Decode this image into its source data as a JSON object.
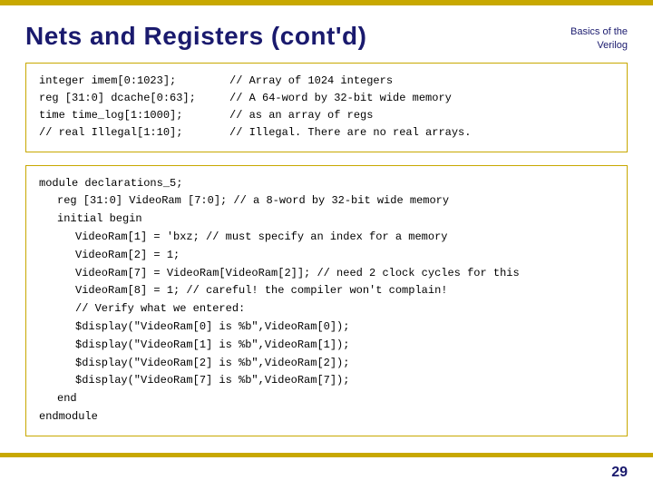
{
  "topBar": {},
  "header": {
    "title": "Nets and Registers (cont'd)",
    "topRightLine1": "Basics of the",
    "topRightLine2": "Verilog"
  },
  "codeBox1": {
    "lines": [
      {
        "col1": "integer imem[0:1023];",
        "col2": "// Array of 1024 integers"
      },
      {
        "col1": "reg [31:0] dcache[0:63];",
        "col2": "// A 64-word by 32-bit wide memory"
      },
      {
        "col1": "time time_log[1:1000];",
        "col2": "// as an array of regs"
      },
      {
        "col1": "// real Illegal[1:10];",
        "col2": "// Illegal. There are no real arrays."
      }
    ]
  },
  "codeBox2": {
    "lines": [
      {
        "indent": 0,
        "text": "module declarations_5;"
      },
      {
        "indent": 1,
        "text": "reg [31:0] VideoRam [7:0]; // a 8-word by 32-bit wide memory"
      },
      {
        "indent": 1,
        "text": "initial begin"
      },
      {
        "indent": 2,
        "text": "VideoRam[1] = 'bxz; // must specify an index for a memory"
      },
      {
        "indent": 2,
        "text": "VideoRam[2] = 1;"
      },
      {
        "indent": 2,
        "text": "VideoRam[7] = VideoRam[VideoRam[2]]; // need 2 clock cycles for this"
      },
      {
        "indent": 2,
        "text": "VideoRam[8] = 1; // careful! the compiler won't complain!"
      },
      {
        "indent": 2,
        "text": "// Verify what we entered:"
      },
      {
        "indent": 2,
        "text": "$display(\"VideoRam[0] is %b\",VideoRam[0]);"
      },
      {
        "indent": 2,
        "text": "$display(\"VideoRam[1] is %b\",VideoRam[1]);"
      },
      {
        "indent": 2,
        "text": "$display(\"VideoRam[2] is %b\",VideoRam[2]);"
      },
      {
        "indent": 2,
        "text": "$display(\"VideoRam[7] is %b\",VideoRam[7]);"
      },
      {
        "indent": 1,
        "text": "end"
      },
      {
        "indent": 0,
        "text": "endmodule"
      }
    ]
  },
  "pageNumber": "29"
}
